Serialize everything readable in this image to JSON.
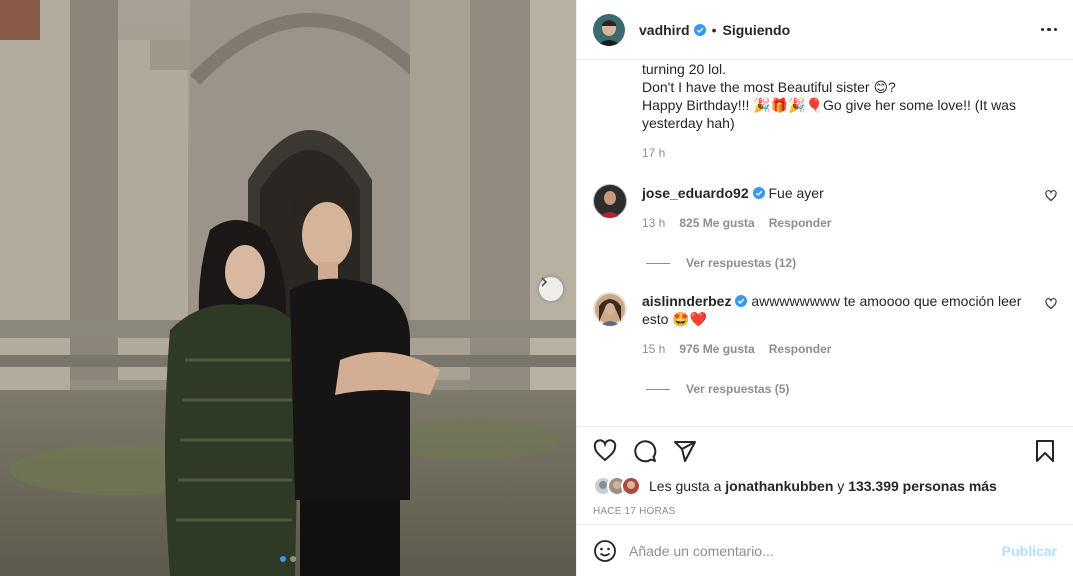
{
  "post": {
    "author": "vadhird",
    "separator": "•",
    "follow_status": "Siguiendo",
    "caption_lines": [
      "turning 20 lol.",
      "Don't I have the most Beautiful sister 😊?",
      "Happy Birthday!!! 🎉🎁🎉🎈Go give her some love!! (It was",
      "yesterday hah)"
    ],
    "caption_time": "17 h"
  },
  "comments": [
    {
      "user": "jose_eduardo92",
      "text": "Fue ayer",
      "time": "13 h",
      "likes": "825 Me gusta",
      "reply": "Responder",
      "view_replies": "Ver respuestas (12)"
    },
    {
      "user": "aislinnderbez",
      "text": "awwwwwwww te amoooo que emoción leer esto 🤩❤️",
      "time": "15 h",
      "likes": "976 Me gusta",
      "reply": "Responder",
      "view_replies": "Ver respuestas (5)"
    }
  ],
  "likes": {
    "prefix": "Les gusta a ",
    "user": "jonathankubben",
    "middle": " y ",
    "others": "133.399 personas más"
  },
  "posted_ago": "HACE 17 HORAS",
  "add_comment": {
    "placeholder": "Añade un comentario...",
    "publish_label": "Publicar"
  },
  "icons": {
    "verified": "verified-badge-icon",
    "more": "more-options-icon",
    "like": "heart-icon",
    "comment": "comment-icon",
    "share": "share-icon",
    "save": "bookmark-icon",
    "emoji": "emoji-icon",
    "next": "chevron-right-icon"
  },
  "colors": {
    "verified_blue": "#3897f0",
    "muted": "#8e8e8e",
    "publish_disabled": "#b2dffc",
    "heart_red": "#ed4956"
  }
}
